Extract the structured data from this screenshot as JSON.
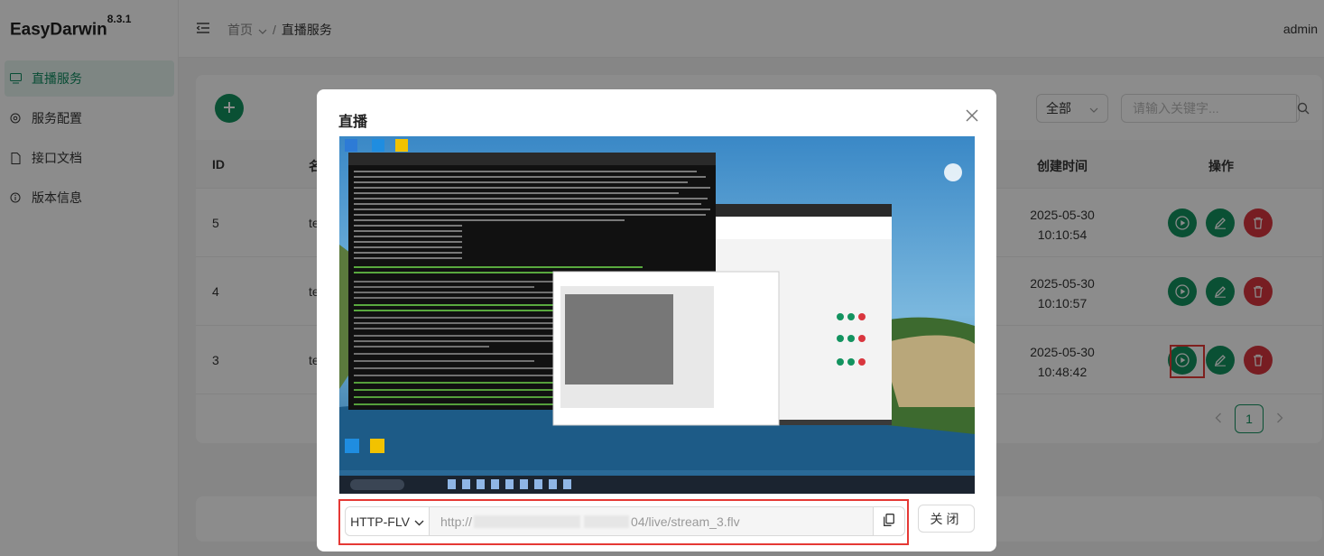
{
  "app": {
    "name": "EasyDarwin",
    "version": "8.3.1"
  },
  "sidebar": {
    "items": [
      {
        "label": "直播服务",
        "icon": "monitor-icon",
        "active": true
      },
      {
        "label": "服务配置",
        "icon": "settings-icon",
        "active": false
      },
      {
        "label": "接口文档",
        "icon": "document-icon",
        "active": false
      },
      {
        "label": "版本信息",
        "icon": "info-icon",
        "active": false
      }
    ]
  },
  "header": {
    "breadcrumb_home": "首页",
    "separator": "/",
    "breadcrumb_current": "直播服务",
    "user": "admin"
  },
  "toolbar": {
    "filter_value": "全部",
    "search_placeholder": "请输入关键字..."
  },
  "table": {
    "columns": {
      "id": "ID",
      "name": "名",
      "created": "创建时间",
      "actions": "操作"
    },
    "rows": [
      {
        "id": "5",
        "name": "te",
        "date": "2025-05-30",
        "time": "10:10:54"
      },
      {
        "id": "4",
        "name": "te",
        "date": "2025-05-30",
        "time": "10:10:57"
      },
      {
        "id": "3",
        "name": "te",
        "date": "2025-05-30",
        "time": "10:48:42"
      }
    ]
  },
  "pagination": {
    "current": "1"
  },
  "modal": {
    "title": "直播",
    "protocol": "HTTP-FLV",
    "url_prefix": "http://",
    "url_suffix": "04/live/stream_3.flv",
    "close_label": "关闭"
  },
  "colors": {
    "primary": "#13935f",
    "danger": "#d9363e",
    "highlight": "#e53935"
  }
}
